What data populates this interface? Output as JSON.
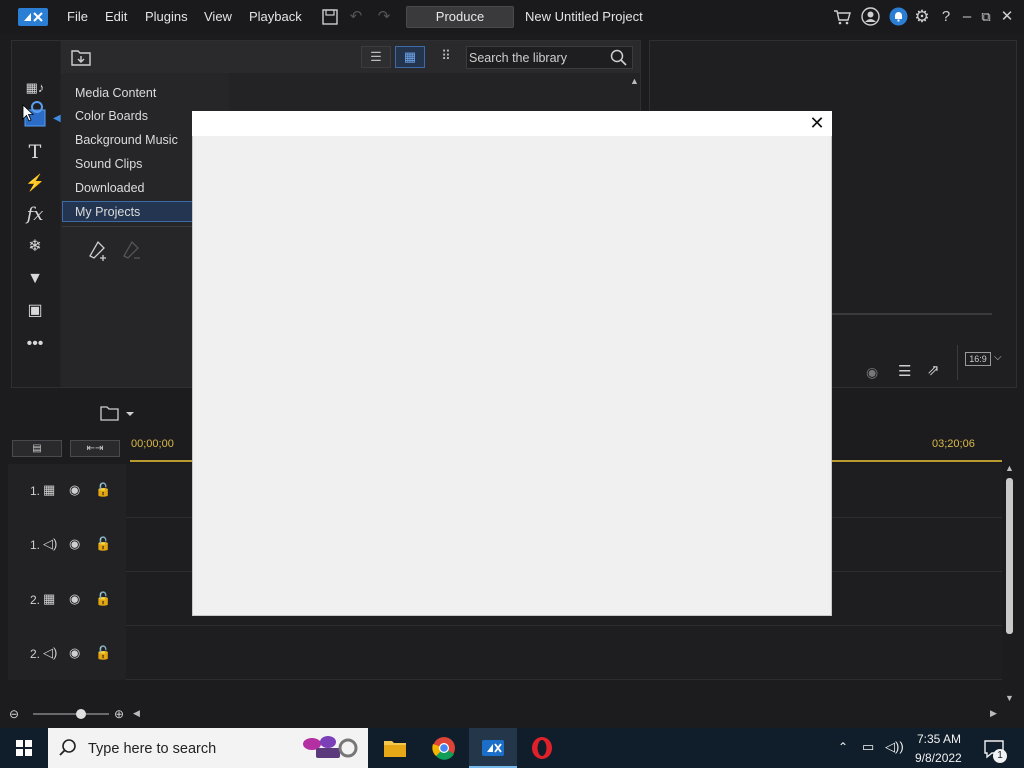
{
  "menu": {
    "file": "File",
    "edit": "Edit",
    "plugins": "Plugins",
    "view": "View",
    "playback": "Playback",
    "produce": "Produce",
    "project_title": "New Untitled Project"
  },
  "library": {
    "search_placeholder": "Search the library",
    "tree": [
      "Media Content",
      "Color Boards",
      "Background Music",
      "Sound Clips",
      "Downloaded",
      "My Projects"
    ]
  },
  "preview": {
    "ratio": "16:9"
  },
  "timeline": {
    "time_start": "00;00;00",
    "time_end": "03;20;06",
    "tracks": [
      "1.",
      "1.",
      "2.",
      "2."
    ]
  },
  "taskbar": {
    "search_placeholder": "Type here to search",
    "time": "7:35 AM",
    "date": "9/8/2022",
    "notification_count": "1"
  },
  "colors": {
    "accent": "#3d6aa8",
    "produce_bg": "#3a3a3d",
    "taskbar": "#101d2a",
    "modal_bg": "#f0f0f0"
  }
}
